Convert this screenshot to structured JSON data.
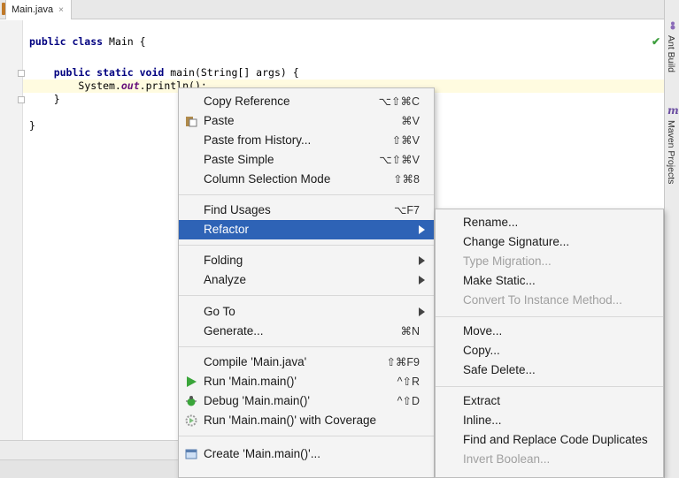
{
  "tab": {
    "title": "Main.java",
    "close": "×"
  },
  "code": {
    "line1": {
      "kw": "public class",
      "rest": " Main {"
    },
    "line2": {
      "kw": "public static void",
      "rest": " main(String[] args) {"
    },
    "line3": {
      "pre": "System.",
      "field": "out",
      "post": ".println();"
    },
    "line4": "}",
    "line5": "}"
  },
  "right_tools": {
    "ant_build": "Ant Build",
    "maven_projects": "Maven Projects"
  },
  "context_menu": {
    "items": [
      {
        "label": "Copy Reference",
        "shortcut": "⌥⇧⌘C"
      },
      {
        "label": "Paste",
        "shortcut": "⌘V"
      },
      {
        "label": "Paste from History...",
        "shortcut": "⇧⌘V"
      },
      {
        "label": "Paste Simple",
        "shortcut": "⌥⇧⌘V"
      },
      {
        "label": "Column Selection Mode",
        "shortcut": "⇧⌘8"
      },
      {
        "label": "Find Usages",
        "shortcut": "⌥F7"
      },
      {
        "label": "Refactor",
        "shortcut": ""
      },
      {
        "label": "Folding",
        "shortcut": ""
      },
      {
        "label": "Analyze",
        "shortcut": ""
      },
      {
        "label": "Go To",
        "shortcut": ""
      },
      {
        "label": "Generate...",
        "shortcut": "⌘N"
      },
      {
        "label": "Compile 'Main.java'",
        "shortcut": "⇧⌘F9"
      },
      {
        "label": "Run 'Main.main()'",
        "shortcut": "^⇧R"
      },
      {
        "label": "Debug 'Main.main()'",
        "shortcut": "^⇧D"
      },
      {
        "label": "Run 'Main.main()' with Coverage",
        "shortcut": ""
      },
      {
        "label": "Create 'Main.main()'...",
        "shortcut": ""
      }
    ]
  },
  "refactor_submenu": {
    "items": [
      {
        "label": "Rename...",
        "enabled": true
      },
      {
        "label": "Change Signature...",
        "enabled": true
      },
      {
        "label": "Type Migration...",
        "enabled": false
      },
      {
        "label": "Make Static...",
        "enabled": true
      },
      {
        "label": "Convert To Instance Method...",
        "enabled": false
      },
      {
        "label": "Move...",
        "enabled": true
      },
      {
        "label": "Copy...",
        "enabled": true
      },
      {
        "label": "Safe Delete...",
        "enabled": true
      },
      {
        "label": "Extract",
        "enabled": true
      },
      {
        "label": "Inline...",
        "enabled": true
      },
      {
        "label": "Find and Replace Code Duplicates",
        "enabled": true
      },
      {
        "label": "Invert Boolean...",
        "enabled": false
      }
    ]
  },
  "colors": {
    "selection": "#2e63b6",
    "keyword": "#000080",
    "field": "#660e7a",
    "run_green": "#3aa53a",
    "check": "#3f9f3f"
  }
}
